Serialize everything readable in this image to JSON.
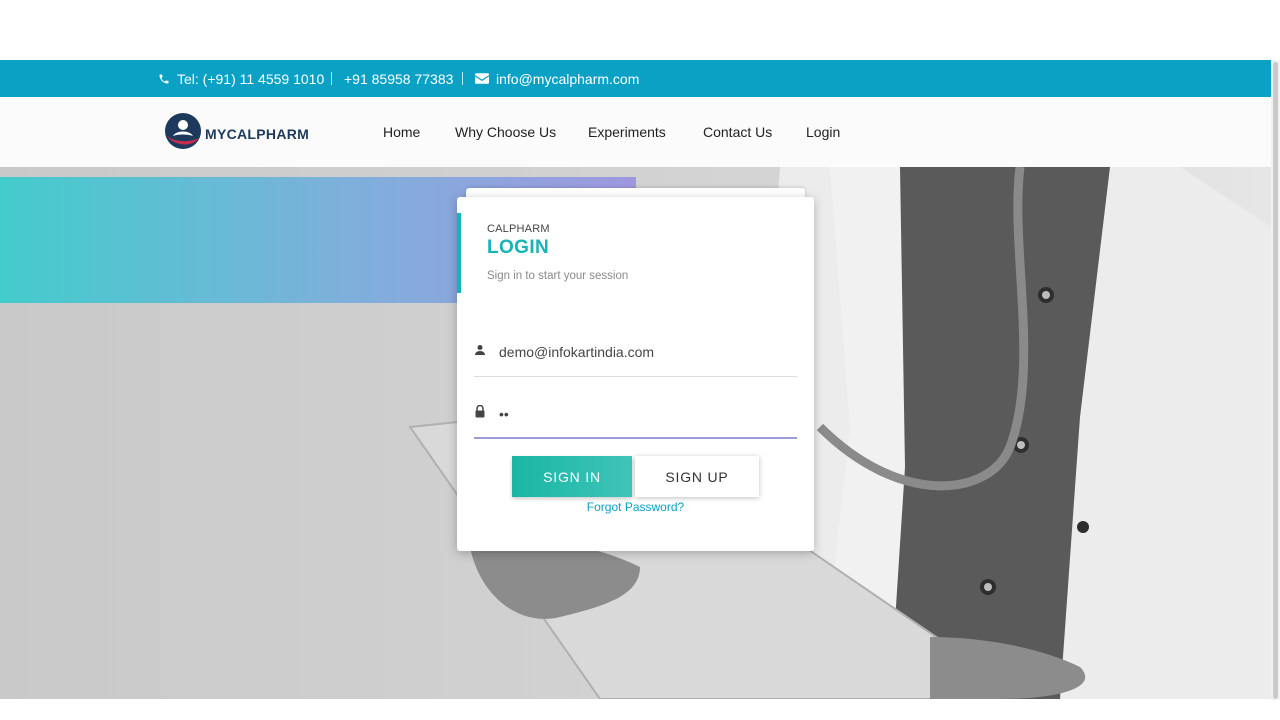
{
  "topbar": {
    "tel": "Tel: (+91) 11 4559 1010",
    "mobile": "+91 85958 77383",
    "email": "info@mycalpharm.com",
    "color": "#0aa1c4"
  },
  "header": {
    "logo_text": "MYCALPHARM",
    "nav": [
      "Home",
      "Why Choose Us",
      "Experiments",
      "Contact Us",
      "Login"
    ]
  },
  "login": {
    "brand": "CALPHARM",
    "title": "LOGIN",
    "subtitle": "Sign in to start your session",
    "email_value": "demo@infokartindia.com",
    "password_value": "••",
    "signin_label": "SIGN IN",
    "signup_label": "SIGN UP",
    "forgot_label": "Forgot Password?",
    "accent_color": "#16b3b8"
  },
  "icons": {
    "phone": "phone-icon",
    "envelope": "envelope-icon",
    "user": "user-icon",
    "lock": "lock-icon"
  }
}
